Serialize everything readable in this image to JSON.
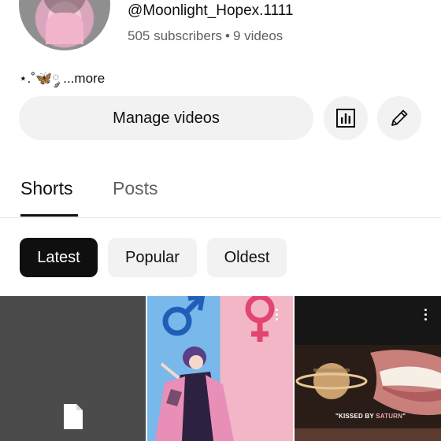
{
  "channel": {
    "handle": "@Moonlight_Hopex.1111",
    "subscribers": "505 subscribers",
    "separator": "•",
    "videos": "9 videos",
    "bio": "⋆.˚🦋༘ ...more"
  },
  "actions": {
    "manage_label": "Manage videos",
    "analytics_icon": "analytics-icon",
    "edit_icon": "pencil-icon"
  },
  "tabs": [
    {
      "label": "Shorts",
      "selected": true
    },
    {
      "label": "Posts",
      "selected": false
    }
  ],
  "filters": [
    {
      "label": "Latest",
      "selected": true
    },
    {
      "label": "Popular",
      "selected": false
    },
    {
      "label": "Oldest",
      "selected": false
    }
  ],
  "shorts": [
    {
      "kind": "processing",
      "icon": "file-icon"
    },
    {
      "kind": "image",
      "description_icon": "gender-symbols"
    },
    {
      "kind": "image",
      "caption_a": "\"KISSED BY ",
      "caption_b": "SATURN",
      "caption_c": "\""
    }
  ],
  "colors": {
    "accent_dark": "#0f0f0f",
    "chip_bg": "#f2f2f2",
    "secondary_text": "#606060"
  }
}
